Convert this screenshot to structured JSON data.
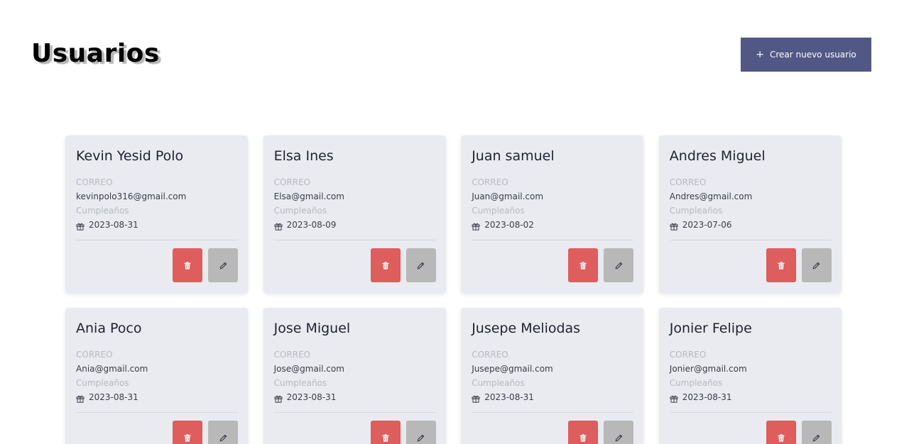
{
  "header": {
    "title": "Usuarios",
    "create_button_label": "Crear nuevo usuario",
    "create_button_icon": "plus-icon"
  },
  "labels": {
    "email": "CORREO",
    "birthday": "Cumpleaños"
  },
  "colors": {
    "button_primary": "#525886",
    "button_delete": "#de5d5d",
    "button_edit": "#b8b8b8",
    "card_background": "#e9ebf0"
  },
  "users": [
    {
      "name": "Kevin Yesid Polo",
      "email": "kevinpolo316@gmail.com",
      "birthday": "2023-08-31"
    },
    {
      "name": "Elsa Ines",
      "email": "Elsa@gmail.com",
      "birthday": "2023-08-09"
    },
    {
      "name": "Juan samuel",
      "email": "Juan@gmail.com",
      "birthday": "2023-08-02"
    },
    {
      "name": "Andres Miguel",
      "email": "Andres@gmail.com",
      "birthday": "2023-07-06"
    },
    {
      "name": "Ania Poco",
      "email": "Ania@gmail.com",
      "birthday": "2023-08-31"
    },
    {
      "name": "Jose Miguel",
      "email": "Jose@gmail.com",
      "birthday": "2023-08-31"
    },
    {
      "name": "Jusepe Meliodas",
      "email": "Jusepe@gmail.com",
      "birthday": "2023-08-31"
    },
    {
      "name": "Jonier Felipe",
      "email": "Jonier@gmail.com",
      "birthday": "2023-08-31"
    }
  ]
}
